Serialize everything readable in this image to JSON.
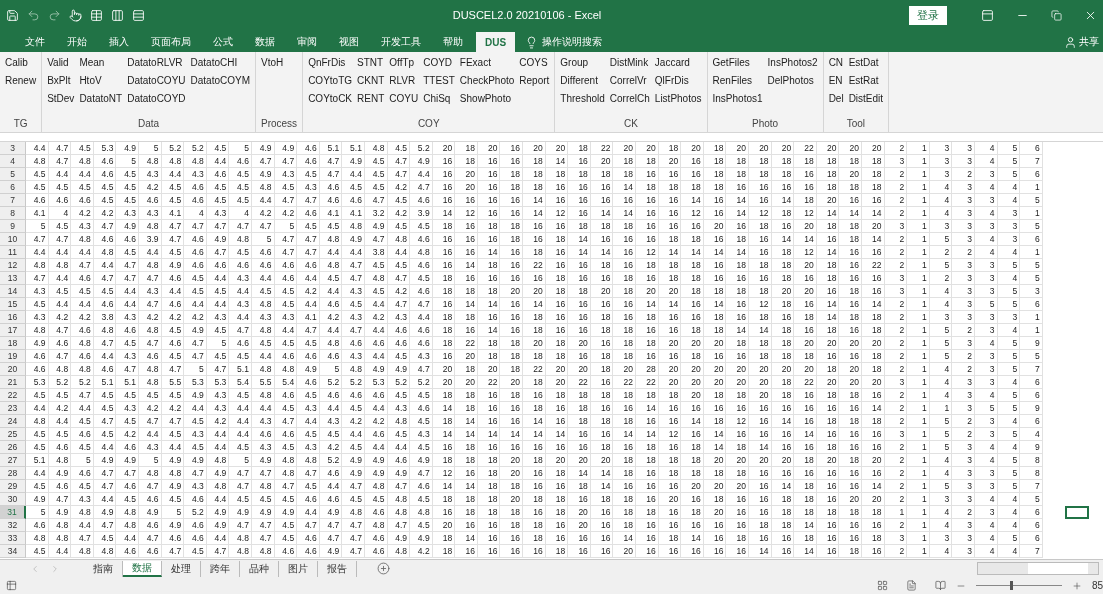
{
  "title_bar": {
    "title": "DUSCEL2.0 20210106  -  Excel",
    "login": "登录"
  },
  "ribbon_tabs": [
    {
      "label": "文件",
      "selected": false
    },
    {
      "label": "开始",
      "selected": false
    },
    {
      "label": "插入",
      "selected": false
    },
    {
      "label": "页面布局",
      "selected": false
    },
    {
      "label": "公式",
      "selected": false
    },
    {
      "label": "数据",
      "selected": false
    },
    {
      "label": "审阅",
      "selected": false
    },
    {
      "label": "视图",
      "selected": false
    },
    {
      "label": "开发工具",
      "selected": false
    },
    {
      "label": "帮助",
      "selected": false
    },
    {
      "label": "DUS",
      "selected": true
    }
  ],
  "search": {
    "label": "操作说明搜索"
  },
  "share": {
    "label": "共享"
  },
  "ribbon_groups": [
    {
      "label": "TG",
      "columns": [
        [
          "Calib",
          "Renew"
        ]
      ]
    },
    {
      "label": "Data",
      "columns": [
        [
          "Valid",
          "BxPlt",
          "StDev"
        ],
        [
          "Mean",
          "HtoV",
          "DatatoNT"
        ],
        [
          "DatatoRLVR",
          "DatatoCOYU",
          "DatatoCOYD"
        ],
        [
          "DatatoCHI",
          "DatatoCOYM"
        ]
      ]
    },
    {
      "label": "Process",
      "columns": [
        [
          "VtoH"
        ]
      ]
    },
    {
      "label": "COY",
      "columns": [
        [
          "QnFrDis",
          "COYtoTG",
          "COYtoCK"
        ],
        [
          "STNT",
          "CKNT",
          "RENT"
        ],
        [
          "OffTp",
          "RLVR",
          "COYU"
        ],
        [
          "COYD",
          "TTEST",
          "ChiSq"
        ],
        [
          "FExact",
          "CheckPhoto",
          "ShowPhoto"
        ],
        [
          "COYS",
          "Report"
        ]
      ]
    },
    {
      "label": "CK",
      "columns": [
        [
          "Group",
          "Different",
          "Threshold"
        ],
        [
          "DistMink",
          "CorrelVr",
          "CorrelCh"
        ],
        [
          "Jaccard",
          "QlFrDis",
          "ListPhotos"
        ]
      ]
    },
    {
      "label": "Photo",
      "columns": [
        [
          "GetFiles",
          "RenFiles",
          "InsPhotos1"
        ],
        [
          "InsPhotos2",
          "DelPhotos"
        ]
      ]
    },
    {
      "label": "Tool",
      "columns": [
        [
          "CN",
          "EN",
          "Del"
        ],
        [
          "EstDat",
          "EstRat",
          "DistEdit"
        ]
      ]
    }
  ],
  "sheet": {
    "rows": [
      {
        "label": "3",
        "selected": false,
        "cells": [
          "4.4",
          "4.7",
          "4.5",
          "5.3",
          "4.9",
          "5",
          "5.2",
          "5.2",
          "4.5",
          "5",
          "4.9",
          "4.9",
          "4.6",
          "5.1",
          "5.1",
          "4.8",
          "4.5",
          "5.2",
          "20",
          "18",
          "20",
          "16",
          "20",
          "20",
          "18",
          "22",
          "20",
          "20",
          "18",
          "20",
          "18",
          "20",
          "20",
          "20",
          "22",
          "20",
          "20",
          "20",
          "2",
          "1",
          "3",
          "3",
          "4",
          "5",
          "6"
        ]
      },
      {
        "label": "4",
        "selected": false,
        "cells": [
          "4.8",
          "4.7",
          "4.8",
          "4.6",
          "5",
          "4.8",
          "4.8",
          "4.8",
          "4.4",
          "4.6",
          "4.7",
          "4.7",
          "4.6",
          "4.7",
          "4.9",
          "4.5",
          "4.7",
          "4.9",
          "16",
          "18",
          "16",
          "16",
          "18",
          "14",
          "16",
          "20",
          "18",
          "18",
          "20",
          "16",
          "18",
          "18",
          "18",
          "18",
          "18",
          "18",
          "18",
          "18",
          "3",
          "1",
          "3",
          "3",
          "4",
          "5",
          "7"
        ]
      },
      {
        "label": "5",
        "selected": false,
        "cells": [
          "4.5",
          "4.4",
          "4.4",
          "4.6",
          "4.5",
          "4.3",
          "4.4",
          "4.3",
          "4.6",
          "4.5",
          "4.9",
          "4.3",
          "4.5",
          "4.7",
          "4.4",
          "4.5",
          "4.7",
          "4.4",
          "16",
          "20",
          "16",
          "18",
          "18",
          "18",
          "18",
          "18",
          "18",
          "16",
          "16",
          "16",
          "18",
          "18",
          "18",
          "18",
          "16",
          "18",
          "20",
          "18",
          "2",
          "1",
          "3",
          "2",
          "3",
          "5",
          "6"
        ]
      },
      {
        "label": "6",
        "selected": false,
        "cells": [
          "4.5",
          "4.5",
          "4.5",
          "4.5",
          "4.5",
          "4.2",
          "4.5",
          "4.6",
          "4.5",
          "4.5",
          "4.8",
          "4.5",
          "4.3",
          "4.6",
          "4.5",
          "4.5",
          "4.2",
          "4.7",
          "16",
          "20",
          "16",
          "18",
          "18",
          "16",
          "16",
          "16",
          "14",
          "18",
          "18",
          "18",
          "18",
          "16",
          "16",
          "16",
          "16",
          "18",
          "18",
          "18",
          "2",
          "1",
          "4",
          "3",
          "4",
          "4",
          "1"
        ]
      },
      {
        "label": "7",
        "selected": false,
        "cells": [
          "4.6",
          "4.6",
          "4.6",
          "4.5",
          "4.5",
          "4.6",
          "4.5",
          "4.6",
          "4.5",
          "4.5",
          "4.4",
          "4.7",
          "4.7",
          "4.6",
          "4.6",
          "4.7",
          "4.5",
          "4.6",
          "16",
          "16",
          "16",
          "16",
          "14",
          "16",
          "16",
          "16",
          "16",
          "16",
          "16",
          "14",
          "16",
          "14",
          "16",
          "14",
          "18",
          "20",
          "16",
          "16",
          "2",
          "1",
          "4",
          "3",
          "3",
          "4",
          "5"
        ]
      },
      {
        "label": "8",
        "selected": false,
        "cells": [
          "4.1",
          "4",
          "4.2",
          "4.2",
          "4.3",
          "4.3",
          "4.1",
          "4",
          "4.3",
          "4",
          "4.2",
          "4.2",
          "4.6",
          "4.1",
          "4.1",
          "3.2",
          "4.2",
          "3.9",
          "14",
          "12",
          "16",
          "16",
          "14",
          "12",
          "16",
          "14",
          "14",
          "16",
          "16",
          "12",
          "16",
          "14",
          "12",
          "18",
          "12",
          "14",
          "14",
          "14",
          "2",
          "1",
          "4",
          "3",
          "4",
          "3",
          "1"
        ]
      },
      {
        "label": "9",
        "selected": false,
        "cells": [
          "5",
          "4.5",
          "4.3",
          "4.7",
          "4.9",
          "4.8",
          "4.7",
          "4.7",
          "4.7",
          "4.7",
          "4.7",
          "5",
          "4.5",
          "4.5",
          "4.8",
          "4.9",
          "4.5",
          "4.5",
          "18",
          "16",
          "18",
          "18",
          "16",
          "16",
          "18",
          "18",
          "18",
          "16",
          "16",
          "16",
          "20",
          "16",
          "18",
          "16",
          "20",
          "18",
          "18",
          "20",
          "3",
          "1",
          "3",
          "3",
          "3",
          "3",
          "5"
        ]
      },
      {
        "label": "10",
        "selected": false,
        "cells": [
          "4.7",
          "4.7",
          "4.8",
          "4.6",
          "4.6",
          "3.9",
          "4.7",
          "4.6",
          "4.9",
          "4.8",
          "5",
          "4.7",
          "4.7",
          "4.8",
          "4.9",
          "4.7",
          "4.8",
          "4.6",
          "16",
          "16",
          "16",
          "18",
          "16",
          "18",
          "14",
          "16",
          "16",
          "16",
          "18",
          "18",
          "16",
          "18",
          "16",
          "14",
          "14",
          "16",
          "18",
          "14",
          "2",
          "1",
          "5",
          "3",
          "4",
          "3",
          "6"
        ]
      },
      {
        "label": "11",
        "selected": false,
        "cells": [
          "4.4",
          "4.4",
          "4.4",
          "4.8",
          "4.5",
          "4.4",
          "4.5",
          "4.6",
          "4.7",
          "4.5",
          "4.6",
          "4.7",
          "4.7",
          "4.4",
          "4.4",
          "3.8",
          "4.4",
          "4.8",
          "16",
          "16",
          "14",
          "16",
          "18",
          "16",
          "14",
          "14",
          "16",
          "12",
          "14",
          "14",
          "14",
          "14",
          "16",
          "18",
          "12",
          "14",
          "16",
          "16",
          "2",
          "1",
          "2",
          "2",
          "4",
          "4",
          "1"
        ]
      },
      {
        "label": "12",
        "selected": false,
        "cells": [
          "4.8",
          "4.8",
          "4.7",
          "4.4",
          "4.7",
          "4.8",
          "4.9",
          "4.6",
          "4.6",
          "4.6",
          "4.6",
          "4.6",
          "4.6",
          "4.8",
          "4.7",
          "4.5",
          "4.5",
          "4.6",
          "16",
          "14",
          "18",
          "16",
          "22",
          "16",
          "16",
          "18",
          "16",
          "18",
          "18",
          "18",
          "16",
          "18",
          "18",
          "18",
          "20",
          "18",
          "16",
          "22",
          "2",
          "1",
          "5",
          "3",
          "3",
          "5",
          "5"
        ]
      },
      {
        "label": "13",
        "selected": false,
        "cells": [
          "4.7",
          "4.4",
          "4.6",
          "4.7",
          "4.7",
          "4.7",
          "4.6",
          "4.5",
          "4.4",
          "4.3",
          "4.4",
          "4.6",
          "4.4",
          "4.5",
          "4.7",
          "4.8",
          "4.7",
          "4.5",
          "18",
          "16",
          "16",
          "16",
          "16",
          "18",
          "16",
          "16",
          "18",
          "16",
          "18",
          "18",
          "16",
          "16",
          "16",
          "18",
          "16",
          "18",
          "16",
          "16",
          "3",
          "1",
          "2",
          "3",
          "3",
          "4",
          "5"
        ]
      },
      {
        "label": "14",
        "selected": false,
        "cells": [
          "4.3",
          "4.5",
          "4.5",
          "4.5",
          "4.4",
          "4.3",
          "4.4",
          "4.5",
          "4.5",
          "4.4",
          "4.5",
          "4.5",
          "4.2",
          "4.4",
          "4.3",
          "4.5",
          "4.2",
          "4.6",
          "18",
          "18",
          "18",
          "20",
          "20",
          "18",
          "18",
          "20",
          "18",
          "20",
          "20",
          "18",
          "18",
          "18",
          "18",
          "20",
          "20",
          "16",
          "18",
          "16",
          "3",
          "1",
          "4",
          "3",
          "3",
          "5",
          "3"
        ]
      },
      {
        "label": "15",
        "selected": false,
        "cells": [
          "4.5",
          "4.4",
          "4.4",
          "4.6",
          "4.4",
          "4.7",
          "4.6",
          "4.4",
          "4.4",
          "4.3",
          "4.8",
          "4.5",
          "4.4",
          "4.6",
          "4.5",
          "4.4",
          "4.7",
          "4.7",
          "16",
          "14",
          "14",
          "16",
          "14",
          "16",
          "16",
          "16",
          "16",
          "14",
          "14",
          "16",
          "14",
          "16",
          "12",
          "18",
          "16",
          "14",
          "16",
          "14",
          "2",
          "1",
          "4",
          "3",
          "5",
          "5",
          "6"
        ]
      },
      {
        "label": "16",
        "selected": false,
        "cells": [
          "4.3",
          "4.2",
          "4.2",
          "3.8",
          "4.3",
          "4.2",
          "4.2",
          "4.2",
          "4.3",
          "4.4",
          "4.3",
          "4.3",
          "4.1",
          "4.2",
          "4.3",
          "4.2",
          "4.3",
          "4.4",
          "18",
          "18",
          "16",
          "16",
          "18",
          "16",
          "16",
          "18",
          "16",
          "18",
          "16",
          "16",
          "18",
          "16",
          "18",
          "16",
          "18",
          "14",
          "18",
          "18",
          "2",
          "1",
          "3",
          "3",
          "3",
          "3",
          "1"
        ]
      },
      {
        "label": "17",
        "selected": false,
        "cells": [
          "4.8",
          "4.7",
          "4.6",
          "4.8",
          "4.6",
          "4.8",
          "4.5",
          "4.9",
          "4.5",
          "4.7",
          "4.8",
          "4.4",
          "4.7",
          "4.4",
          "4.7",
          "4.4",
          "4.6",
          "4.6",
          "18",
          "16",
          "14",
          "16",
          "18",
          "16",
          "16",
          "18",
          "18",
          "16",
          "16",
          "18",
          "18",
          "14",
          "14",
          "18",
          "16",
          "18",
          "16",
          "18",
          "2",
          "1",
          "5",
          "2",
          "3",
          "4",
          "1"
        ]
      },
      {
        "label": "18",
        "selected": false,
        "cells": [
          "4.9",
          "4.6",
          "4.8",
          "4.7",
          "4.5",
          "4.7",
          "4.6",
          "4.7",
          "5",
          "4.6",
          "4.5",
          "4.5",
          "4.5",
          "4.8",
          "4.6",
          "4.6",
          "4.6",
          "4.6",
          "18",
          "22",
          "18",
          "18",
          "20",
          "18",
          "20",
          "16",
          "18",
          "18",
          "20",
          "20",
          "20",
          "18",
          "18",
          "18",
          "20",
          "20",
          "20",
          "20",
          "2",
          "1",
          "5",
          "3",
          "4",
          "5",
          "9"
        ]
      },
      {
        "label": "19",
        "selected": false,
        "cells": [
          "4.6",
          "4.7",
          "4.6",
          "4.4",
          "4.3",
          "4.6",
          "4.5",
          "4.7",
          "4.5",
          "4.5",
          "4.4",
          "4.6",
          "4.6",
          "4.6",
          "4.3",
          "4.4",
          "4.5",
          "4.3",
          "16",
          "20",
          "18",
          "18",
          "18",
          "18",
          "16",
          "18",
          "18",
          "16",
          "16",
          "18",
          "16",
          "16",
          "18",
          "18",
          "18",
          "16",
          "16",
          "18",
          "2",
          "1",
          "5",
          "2",
          "3",
          "5",
          "5"
        ]
      },
      {
        "label": "20",
        "selected": false,
        "cells": [
          "4.6",
          "4.8",
          "4.8",
          "4.6",
          "4.7",
          "4.8",
          "4.7",
          "5",
          "4.7",
          "5.1",
          "4.8",
          "4.8",
          "4.9",
          "5",
          "4.8",
          "4.9",
          "4.9",
          "4.7",
          "20",
          "18",
          "20",
          "18",
          "22",
          "20",
          "20",
          "18",
          "20",
          "28",
          "20",
          "20",
          "20",
          "20",
          "20",
          "20",
          "20",
          "18",
          "20",
          "18",
          "2",
          "1",
          "4",
          "2",
          "3",
          "5",
          "7"
        ]
      },
      {
        "label": "21",
        "selected": false,
        "cells": [
          "5.3",
          "5.2",
          "5.2",
          "5.1",
          "5.1",
          "4.8",
          "5.5",
          "5.3",
          "5.3",
          "5.4",
          "5.5",
          "5.4",
          "4.6",
          "5.2",
          "5.2",
          "5.3",
          "5.2",
          "5.2",
          "20",
          "20",
          "22",
          "20",
          "18",
          "20",
          "22",
          "16",
          "22",
          "22",
          "20",
          "20",
          "20",
          "20",
          "20",
          "18",
          "22",
          "20",
          "20",
          "20",
          "3",
          "1",
          "4",
          "3",
          "3",
          "4",
          "6"
        ]
      },
      {
        "label": "22",
        "selected": false,
        "cells": [
          "4.5",
          "4.5",
          "4.7",
          "4.5",
          "4.5",
          "4.5",
          "4.5",
          "4.9",
          "4.3",
          "4.5",
          "4.8",
          "4.6",
          "4.5",
          "4.6",
          "4.6",
          "4.6",
          "4.5",
          "4.5",
          "18",
          "18",
          "16",
          "18",
          "16",
          "18",
          "18",
          "18",
          "18",
          "18",
          "18",
          "20",
          "18",
          "18",
          "20",
          "18",
          "16",
          "18",
          "18",
          "16",
          "2",
          "1",
          "4",
          "3",
          "4",
          "5",
          "6"
        ]
      },
      {
        "label": "23",
        "selected": false,
        "cells": [
          "4.4",
          "4.2",
          "4.4",
          "4.5",
          "4.3",
          "4.2",
          "4.2",
          "4.4",
          "4.3",
          "4.4",
          "4.4",
          "4.5",
          "4.3",
          "4.4",
          "4.5",
          "4.4",
          "4.3",
          "4.6",
          "14",
          "18",
          "16",
          "16",
          "18",
          "16",
          "18",
          "16",
          "16",
          "14",
          "16",
          "16",
          "16",
          "16",
          "16",
          "16",
          "16",
          "16",
          "16",
          "14",
          "2",
          "1",
          "1",
          "3",
          "5",
          "5",
          "9"
        ]
      },
      {
        "label": "24",
        "selected": false,
        "cells": [
          "4.8",
          "4.4",
          "4.5",
          "4.7",
          "4.5",
          "4.7",
          "4.7",
          "4.5",
          "4.2",
          "4.4",
          "4.3",
          "4.7",
          "4.4",
          "4.3",
          "4.2",
          "4.2",
          "4.8",
          "4.5",
          "18",
          "14",
          "16",
          "16",
          "14",
          "16",
          "18",
          "18",
          "18",
          "16",
          "16",
          "14",
          "18",
          "12",
          "16",
          "14",
          "16",
          "18",
          "18",
          "18",
          "2",
          "1",
          "5",
          "2",
          "3",
          "4",
          "6"
        ]
      },
      {
        "label": "25",
        "selected": false,
        "cells": [
          "4.5",
          "4.5",
          "4.6",
          "4.5",
          "4.2",
          "4.4",
          "4.5",
          "4.3",
          "4.4",
          "4.4",
          "4.6",
          "4.6",
          "4.5",
          "4.5",
          "4.4",
          "4.6",
          "4.5",
          "4.3",
          "14",
          "14",
          "14",
          "14",
          "14",
          "14",
          "16",
          "16",
          "14",
          "14",
          "12",
          "16",
          "14",
          "16",
          "16",
          "16",
          "14",
          "16",
          "16",
          "16",
          "3",
          "1",
          "5",
          "2",
          "3",
          "5",
          "4"
        ]
      },
      {
        "label": "26",
        "selected": false,
        "cells": [
          "4.5",
          "4.6",
          "4.5",
          "4.4",
          "4.6",
          "4.3",
          "4.4",
          "4.5",
          "4.4",
          "4.5",
          "4.3",
          "4.5",
          "4.3",
          "4.2",
          "4.5",
          "4.4",
          "4.4",
          "4.5",
          "16",
          "18",
          "16",
          "16",
          "16",
          "16",
          "16",
          "18",
          "16",
          "18",
          "16",
          "18",
          "14",
          "18",
          "14",
          "16",
          "16",
          "18",
          "16",
          "16",
          "2",
          "1",
          "5",
          "3",
          "4",
          "4",
          "9"
        ]
      },
      {
        "label": "27",
        "selected": false,
        "cells": [
          "5.1",
          "4.8",
          "5",
          "4.9",
          "4.9",
          "5",
          "4.9",
          "4.9",
          "4.8",
          "5",
          "4.9",
          "4.8",
          "4.8",
          "5.2",
          "4.9",
          "4.9",
          "4.6",
          "4.9",
          "18",
          "18",
          "18",
          "20",
          "18",
          "20",
          "20",
          "20",
          "18",
          "18",
          "18",
          "18",
          "20",
          "20",
          "20",
          "20",
          "18",
          "20",
          "18",
          "20",
          "2",
          "1",
          "4",
          "3",
          "4",
          "5",
          "8"
        ]
      },
      {
        "label": "28",
        "selected": false,
        "cells": [
          "4.4",
          "4.9",
          "4.6",
          "4.7",
          "4.7",
          "4.8",
          "4.8",
          "4.7",
          "4.9",
          "4.7",
          "4.7",
          "4.8",
          "4.7",
          "4.6",
          "4.9",
          "4.9",
          "4.9",
          "4.7",
          "12",
          "16",
          "18",
          "20",
          "16",
          "18",
          "14",
          "14",
          "18",
          "16",
          "18",
          "18",
          "18",
          "18",
          "16",
          "16",
          "16",
          "16",
          "16",
          "16",
          "2",
          "1",
          "4",
          "3",
          "3",
          "5",
          "8"
        ]
      },
      {
        "label": "29",
        "selected": false,
        "cells": [
          "4.5",
          "4.6",
          "4.5",
          "4.7",
          "4.6",
          "4.7",
          "4.9",
          "4.3",
          "4.8",
          "4.7",
          "4.8",
          "4.7",
          "4.5",
          "4.4",
          "4.7",
          "4.8",
          "4.7",
          "4.6",
          "14",
          "14",
          "18",
          "18",
          "16",
          "16",
          "18",
          "14",
          "16",
          "16",
          "16",
          "20",
          "20",
          "20",
          "16",
          "14",
          "18",
          "16",
          "16",
          "14",
          "2",
          "1",
          "5",
          "3",
          "3",
          "5",
          "7"
        ]
      },
      {
        "label": "30",
        "selected": false,
        "cells": [
          "4.9",
          "4.7",
          "4.3",
          "4.4",
          "4.5",
          "4.6",
          "4.5",
          "4.6",
          "4.4",
          "4.5",
          "4.5",
          "4.5",
          "4.6",
          "4.6",
          "4.5",
          "4.5",
          "4.8",
          "4.5",
          "18",
          "18",
          "18",
          "20",
          "18",
          "18",
          "16",
          "18",
          "18",
          "16",
          "20",
          "16",
          "18",
          "16",
          "16",
          "18",
          "18",
          "16",
          "20",
          "20",
          "2",
          "1",
          "3",
          "3",
          "4",
          "4",
          "5"
        ]
      },
      {
        "label": "31",
        "selected": true,
        "cells": [
          "5",
          "4.9",
          "4.8",
          "4.9",
          "4.8",
          "4.9",
          "5",
          "5.2",
          "4.9",
          "4.9",
          "4.9",
          "4.9",
          "4.4",
          "4.9",
          "4.8",
          "4.6",
          "4.8",
          "4.8",
          "16",
          "18",
          "18",
          "18",
          "16",
          "18",
          "20",
          "16",
          "18",
          "18",
          "16",
          "18",
          "20",
          "16",
          "16",
          "18",
          "18",
          "18",
          "18",
          "18",
          "1",
          "1",
          "4",
          "2",
          "3",
          "4",
          "6"
        ]
      },
      {
        "label": "32",
        "selected": false,
        "cells": [
          "4.6",
          "4.8",
          "4.4",
          "4.7",
          "4.8",
          "4.6",
          "4.9",
          "4.6",
          "4.9",
          "4.7",
          "4.7",
          "4.5",
          "4.7",
          "4.7",
          "4.7",
          "4.8",
          "4.7",
          "4.5",
          "20",
          "16",
          "16",
          "18",
          "18",
          "16",
          "20",
          "16",
          "18",
          "16",
          "16",
          "16",
          "16",
          "16",
          "18",
          "18",
          "14",
          "16",
          "16",
          "16",
          "2",
          "1",
          "4",
          "3",
          "4",
          "4",
          "6"
        ]
      },
      {
        "label": "33",
        "selected": false,
        "cells": [
          "4.8",
          "4.8",
          "4.7",
          "4.5",
          "4.4",
          "4.7",
          "4.6",
          "4.6",
          "4.4",
          "4.8",
          "4.7",
          "4.5",
          "4.6",
          "4.7",
          "4.7",
          "4.6",
          "4.9",
          "4.9",
          "18",
          "14",
          "16",
          "16",
          "18",
          "16",
          "16",
          "16",
          "14",
          "16",
          "18",
          "14",
          "16",
          "18",
          "16",
          "16",
          "18",
          "16",
          "16",
          "18",
          "3",
          "1",
          "3",
          "3",
          "4",
          "5",
          "6"
        ]
      },
      {
        "label": "34",
        "selected": false,
        "cells": [
          "4.5",
          "4.4",
          "4.8",
          "4.8",
          "4.6",
          "4.6",
          "4.7",
          "4.5",
          "4.7",
          "4.8",
          "4.8",
          "4.6",
          "4.6",
          "4.9",
          "4.7",
          "4.6",
          "4.8",
          "4.2",
          "18",
          "16",
          "16",
          "16",
          "16",
          "18",
          "16",
          "16",
          "20",
          "16",
          "16",
          "16",
          "16",
          "16",
          "14",
          "16",
          "14",
          "16",
          "18",
          "16",
          "2",
          "1",
          "4",
          "3",
          "4",
          "4",
          "7"
        ]
      }
    ]
  },
  "sheet_tabs": [
    {
      "label": "指南",
      "selected": false
    },
    {
      "label": "数据",
      "selected": true
    },
    {
      "label": "处理",
      "selected": false
    },
    {
      "label": "跨年",
      "selected": false
    },
    {
      "label": "品种",
      "selected": false
    },
    {
      "label": "图片",
      "selected": false
    },
    {
      "label": "报告",
      "selected": false
    }
  ],
  "status_bar": {
    "zoom": {
      "level": 0.4,
      "reading": "85"
    }
  }
}
